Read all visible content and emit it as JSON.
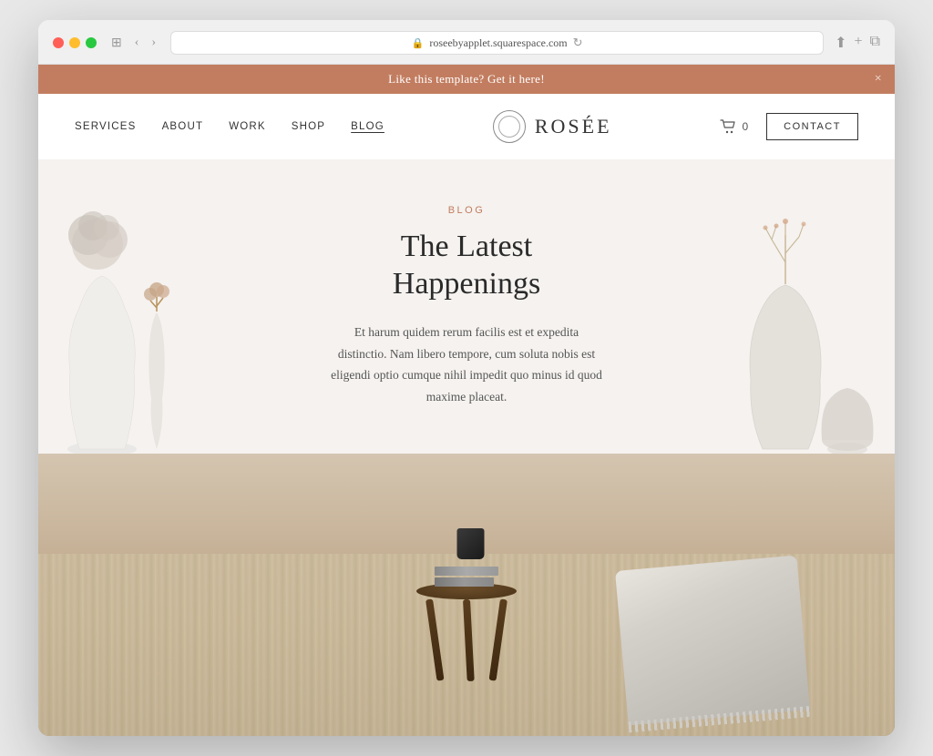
{
  "browser": {
    "url": "roseebyapplet.squarespace.com",
    "back_btn": "‹",
    "forward_btn": "›",
    "window_btn": "⊞",
    "share_btn": "⬆",
    "new_tab_btn": "+",
    "tabs_btn": "⧉"
  },
  "announcement": {
    "text": "Like this template? Get it here!",
    "close_label": "×"
  },
  "nav": {
    "links": [
      {
        "label": "SERVICES",
        "active": false
      },
      {
        "label": "ABOUT",
        "active": false
      },
      {
        "label": "WORK",
        "active": false
      },
      {
        "label": "SHOP",
        "active": false
      },
      {
        "label": "BLOG",
        "active": true
      }
    ],
    "logo_text": "ROSÉE",
    "cart_count": "0",
    "contact_label": "CONTACT"
  },
  "hero": {
    "eyebrow": "BLOG",
    "title": "The Latest Happenings",
    "body": "Et harum quidem rerum facilis est et expedita distinctio. Nam libero tempore, cum soluta nobis est eligendi optio cumque nihil impedit quo minus id quod maxime placeat."
  },
  "colors": {
    "accent": "#c27d60",
    "dark": "#2a2a2a",
    "light_bg": "#f5f2ef"
  }
}
